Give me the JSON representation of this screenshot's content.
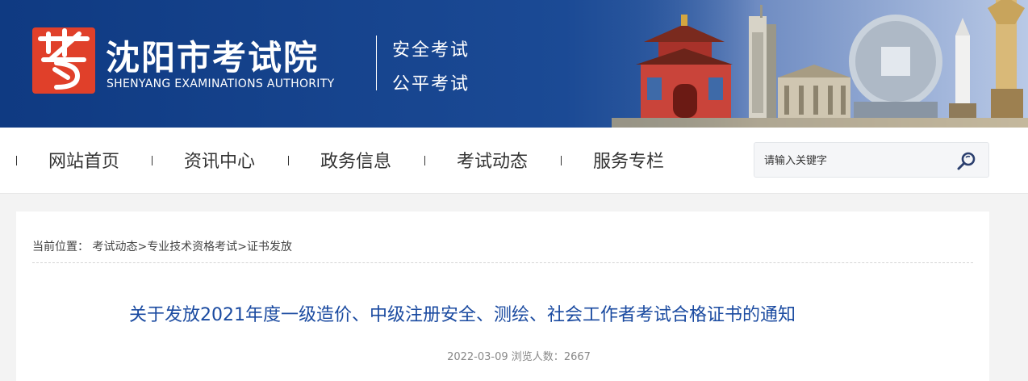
{
  "header": {
    "brand_cn": "沈阳市考试院",
    "brand_en": "SHENYANG EXAMINATIONS AUTHORITY",
    "logo_glyph": "考",
    "slogan_1": "安全考试",
    "slogan_2": "公平考试",
    "colors": {
      "banner": "#0f3a82",
      "logo_red": "#e0402a"
    }
  },
  "nav": {
    "items": [
      {
        "label": "网站首页"
      },
      {
        "label": "资讯中心"
      },
      {
        "label": "政务信息"
      },
      {
        "label": "考试动态"
      },
      {
        "label": "服务专栏"
      }
    ],
    "search": {
      "placeholder": "请输入关键字",
      "icon": "search-icon"
    }
  },
  "breadcrumb": {
    "prefix": "当前位置：",
    "items": [
      "考试动态",
      "专业技术资格考试",
      "证书发放"
    ],
    "separator": ">"
  },
  "article": {
    "title": "关于发放2021年度一级造价、中级注册安全、测绘、社会工作者考试合格证书的通知",
    "date": "2022-03-09",
    "views_label": "浏览人数：",
    "views": "2667",
    "title_color": "#1a4aa0"
  }
}
